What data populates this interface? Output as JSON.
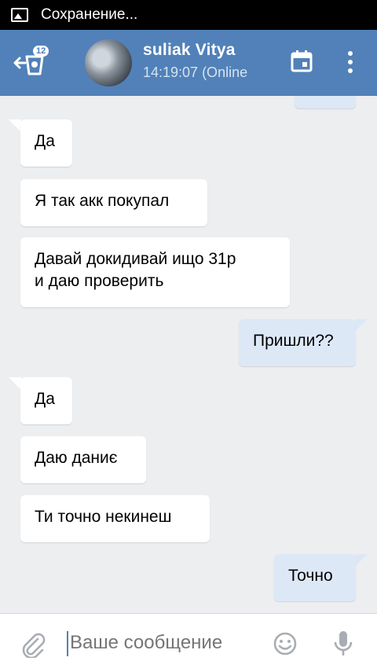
{
  "status_bar": {
    "notification_icon": "image-icon",
    "text": "Сохранение..."
  },
  "header": {
    "unread_count": "12",
    "title": "suliak      Vitya",
    "subtitle": "14:19:07 (Online",
    "calendar_icon": "calendar-icon",
    "more_icon": "more-vertical-icon"
  },
  "messages": [
    {
      "text": "Да",
      "direction": "in"
    },
    {
      "text": "Я так акк покупал",
      "direction": "in"
    },
    {
      "text": "Давай докидивай ищо 31р\nи даю проверить",
      "direction": "in"
    },
    {
      "text": "Пришли??",
      "direction": "out"
    },
    {
      "text": "Да",
      "direction": "in"
    },
    {
      "text": "Даю даниє",
      "direction": "in"
    },
    {
      "text": "Ти точно некинеш",
      "direction": "in"
    },
    {
      "text": "Точно",
      "direction": "out"
    }
  ],
  "composer": {
    "placeholder": "Ваше сообщение",
    "attach_icon": "paperclip-icon",
    "emoji_icon": "smiley-icon",
    "mic_icon": "microphone-icon"
  },
  "colors": {
    "header": "#5181b8",
    "outgoing_bubble": "#dde8f7",
    "incoming_bubble": "#ffffff",
    "background": "#edeef0"
  }
}
